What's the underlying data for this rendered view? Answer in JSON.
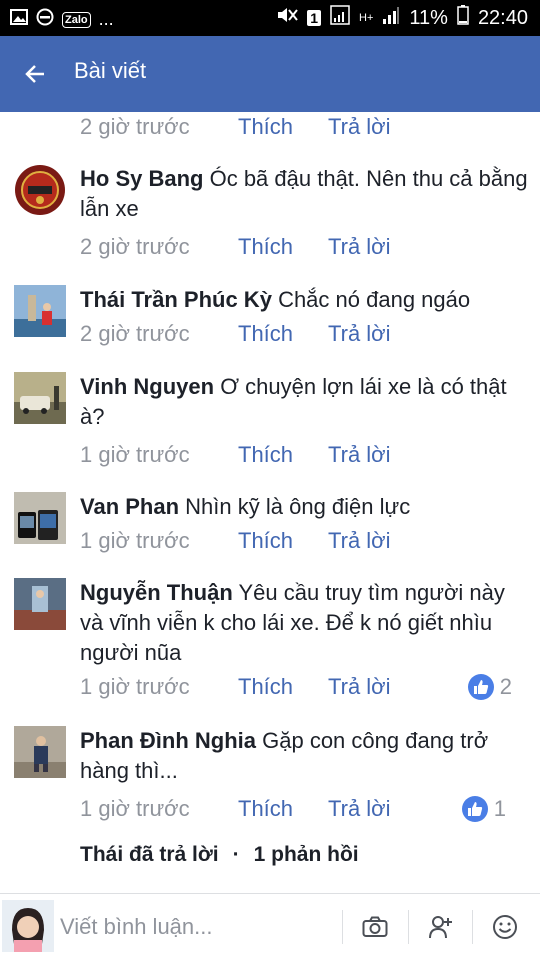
{
  "status_bar": {
    "zalo_label": "Zalo",
    "more": "...",
    "sim_badge": "1",
    "network": "H+",
    "battery": "11%",
    "time": "22:40"
  },
  "app_bar": {
    "title": "Bài viết"
  },
  "comments": [
    {
      "author": "",
      "text": "",
      "time": "2 giờ trước",
      "like": "Thích",
      "reply": "Trả lời"
    },
    {
      "author": "Ho Sy Bang",
      "text": "Óc bã đậu thật. Nên thu cả bằng lẫn xe",
      "time": "2 giờ trước",
      "like": "Thích",
      "reply": "Trả lời"
    },
    {
      "author": "Thái Trần Phúc Kỳ",
      "text": "Chắc nó đang ngáo",
      "time": "2 giờ trước",
      "like": "Thích",
      "reply": "Trả lời"
    },
    {
      "author": "Vinh Nguyen",
      "text": "Ơ chuyện lợn lái xe là có thật à?",
      "time": "1 giờ trước",
      "like": "Thích",
      "reply": "Trả lời"
    },
    {
      "author": "Van Phan",
      "text": "Nhìn kỹ là ông điện lực",
      "time": "1 giờ trước",
      "like": "Thích",
      "reply": "Trả lời"
    },
    {
      "author": "Nguyễn Thuận",
      "text": "Yêu cầu truy tìm người này và vĩnh viễn k cho lái xe. Để k nó giết nhìu người nũa",
      "time": "1 giờ trước",
      "like": "Thích",
      "reply": "Trả lời",
      "reaction_count": "2"
    },
    {
      "author": "Phan Đình Nghia",
      "text": "Gặp con công đang trở hàng thì...",
      "time": "1 giờ trước",
      "like": "Thích",
      "reply": "Trả lời",
      "reaction_count": "1"
    }
  ],
  "replies_summary": {
    "replied": "Thái đã trả lời",
    "separator": "·",
    "count": "1 phản hồi"
  },
  "composer": {
    "placeholder": "Viết bình luận..."
  },
  "colors": {
    "brand": "#4267b2",
    "link": "#4267b2",
    "meta": "#90949c",
    "text": "#1d2129",
    "like_badge": "#4a7ee6"
  },
  "icons": [
    "back-arrow-icon",
    "camera-icon",
    "add-friend-icon",
    "emoji-icon",
    "like-thumb-icon"
  ]
}
